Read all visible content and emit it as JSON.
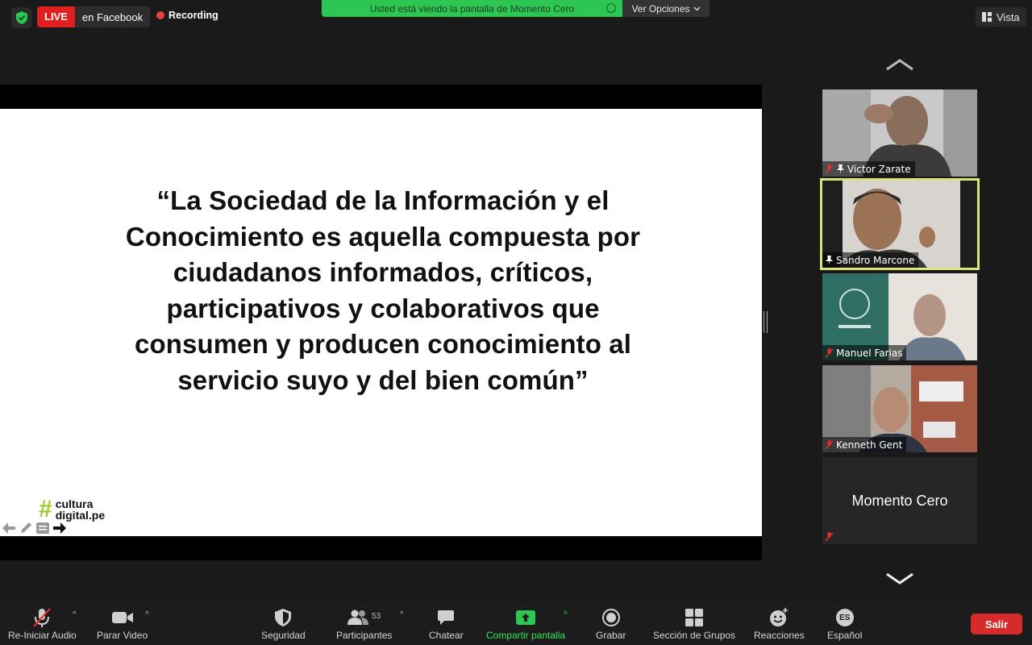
{
  "top_bar": {
    "live_badge": "LIVE",
    "live_destination": "en Facebook",
    "recording": "Recording",
    "share_banner": "Usted está viendo la pantalla de Momento Cero",
    "view_options": "Ver Opciones",
    "view_button": "Vista"
  },
  "slide": {
    "quote_lines": [
      "“La Sociedad de la Información y el",
      "Conocimiento es aquella compuesta por",
      "ciudadanos informados, críticos,",
      "participativos y colaborativos que",
      "consumen y producen conocimiento al",
      "servicio suyo y del bien común”"
    ],
    "logo_line1": "cultura",
    "logo_line2": "digital.pe",
    "logo_hash": "#"
  },
  "participants": [
    {
      "name": "Victor Zarate",
      "muted": true,
      "pinned": true
    },
    {
      "name": "Sandro Marcone",
      "muted": false,
      "pinned": true,
      "active_speaker": true
    },
    {
      "name": "Manuel Farias",
      "muted": true
    },
    {
      "name": "Kenneth Gent",
      "muted": true
    },
    {
      "name": "Momento Cero",
      "muted": true,
      "video_off": true
    }
  ],
  "toolbar": {
    "audio": "Re-Iniciar Audio",
    "video": "Parar Video",
    "security": "Seguridad",
    "participants": "Participantes",
    "participants_count": "53",
    "chat": "Chatear",
    "share": "Compartir pantalla",
    "record": "Grabar",
    "breakout": "Sección de Grupos",
    "reactions": "Reacciones",
    "language": "Español",
    "language_badge": "ES",
    "leave": "Salir"
  },
  "colors": {
    "live": "#e02020",
    "share_banner": "#2dc653",
    "share_button_text": "#2ee65c",
    "active_speaker_border": "#d9e47a",
    "leave": "#d62b2b",
    "logo_hash": "#9ccc2d"
  }
}
